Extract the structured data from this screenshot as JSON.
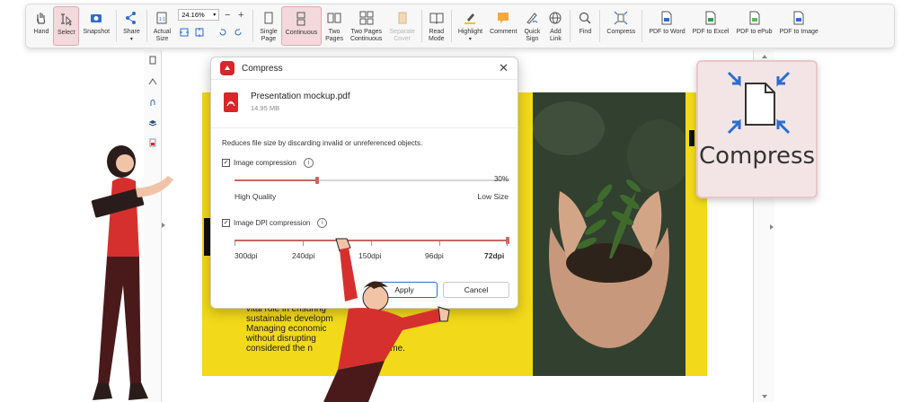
{
  "toolbar": {
    "hand": "Hand",
    "select": "Select",
    "snapshot": "Snapshot",
    "share": "Share",
    "actual_size": [
      "Actual",
      "Size"
    ],
    "zoom_value": "24.16%",
    "zoom_minus": "−",
    "zoom_plus": "+",
    "single_page": [
      "Single",
      "Page"
    ],
    "continuous": "Continuous",
    "two_pages": [
      "Two",
      "Pages"
    ],
    "two_pages_continuous": [
      "Two Pages",
      "Continuous"
    ],
    "separate_cover": [
      "Separate",
      "Cover"
    ],
    "read_mode": [
      "Read",
      "Mode"
    ],
    "highlight": "Highlight",
    "comment": "Comment",
    "quick_sign": [
      "Quick",
      "Sign"
    ],
    "add_link": [
      "Add",
      "Link"
    ],
    "find": "Find",
    "compress": "Compress",
    "pdf_to_word": "PDF to Word",
    "pdf_to_excel": "PDF to Excel",
    "pdf_to_epub": "PDF to ePub",
    "pdf_to_image": "PDF to Image"
  },
  "dialog": {
    "title": "Compress",
    "close_glyph": "✕",
    "file_name": "Presentation mockup.pdf",
    "file_size": "14.95 MB",
    "description": "Reduces file size by discarding invalid or unreferenced objects.",
    "image_compression": {
      "label": "Image compression",
      "checked": true,
      "value": "30%",
      "fraction": 0.3
    },
    "high_quality": "High Quality",
    "low_size": "Low Size",
    "dpi_compression": {
      "label": "Image DPI compression",
      "checked": true,
      "selected": "72dpi"
    },
    "dpi_options": [
      "300dpi",
      "240dpi",
      "150dpi",
      "96dpi",
      "72dpi"
    ],
    "apply": "Apply",
    "cancel": "Cancel",
    "info_glyph": "i",
    "check_glyph": "✓"
  },
  "document": {
    "lines": [
      "vital role in ensuring",
      "sustainable developm",
      "Managing economic",
      "without disrupting",
      "considered the n"
    ],
    "tail": "esent time."
  },
  "callout": {
    "label": "Compress"
  },
  "colors": {
    "accent": "#d9262b",
    "active_bg": "#f3d9dc",
    "yellow": "#f2d91a",
    "slider": "#c9675f"
  }
}
